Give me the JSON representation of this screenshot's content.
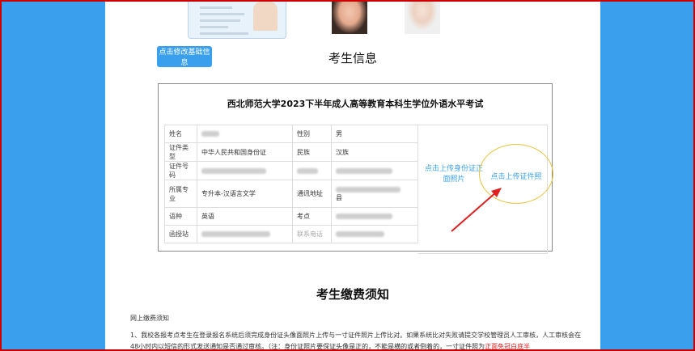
{
  "header": {
    "edit_button_label": "点击修改基础信息",
    "section_title": "考生信息"
  },
  "exam": {
    "title": "西北师范大学2023下半年成人高等教育本科生学位外语水平考试"
  },
  "info_table": {
    "labels": {
      "name": "姓名",
      "gender": "性别",
      "id_type": "证件类型",
      "ethnicity": "民族",
      "id_number": "证件号码",
      "major": "所属专业",
      "address": "通讯地址",
      "language": "语种",
      "exam_site": "考点",
      "station": "函授站",
      "phone": "联系电话"
    },
    "values": {
      "gender": "男",
      "id_type": "中华人民共和国身份证",
      "ethnicity": "汉族",
      "major": "专升本-汉语言文学",
      "address_suffix": "县",
      "language": "英语"
    }
  },
  "upload": {
    "id_photo_link": "点击上传身份证正面照片",
    "cert_photo_link": "点击上传证件照"
  },
  "fee": {
    "section_title": "考生缴费须知",
    "notice_head": "网上缴费须知",
    "notice_body": "1、我校各报考点考生在登录报名系统后须完成身份证头像面照片上传与一寸证件照片上传比对。如果系统比对失败请提交学校管理员人工审核，人工审核会在48小时内以短信的形式发送通知是否通过审核。（注：身份证照片要保证头像是正的，不能是横的或者倒着的，一寸证件照为",
    "notice_red": "正面免冠白底半"
  },
  "colors": {
    "accent": "#3aa0ee",
    "frame": "#cc0000",
    "highlight_circle": "#e8c33a",
    "arrow": "#e02020"
  }
}
